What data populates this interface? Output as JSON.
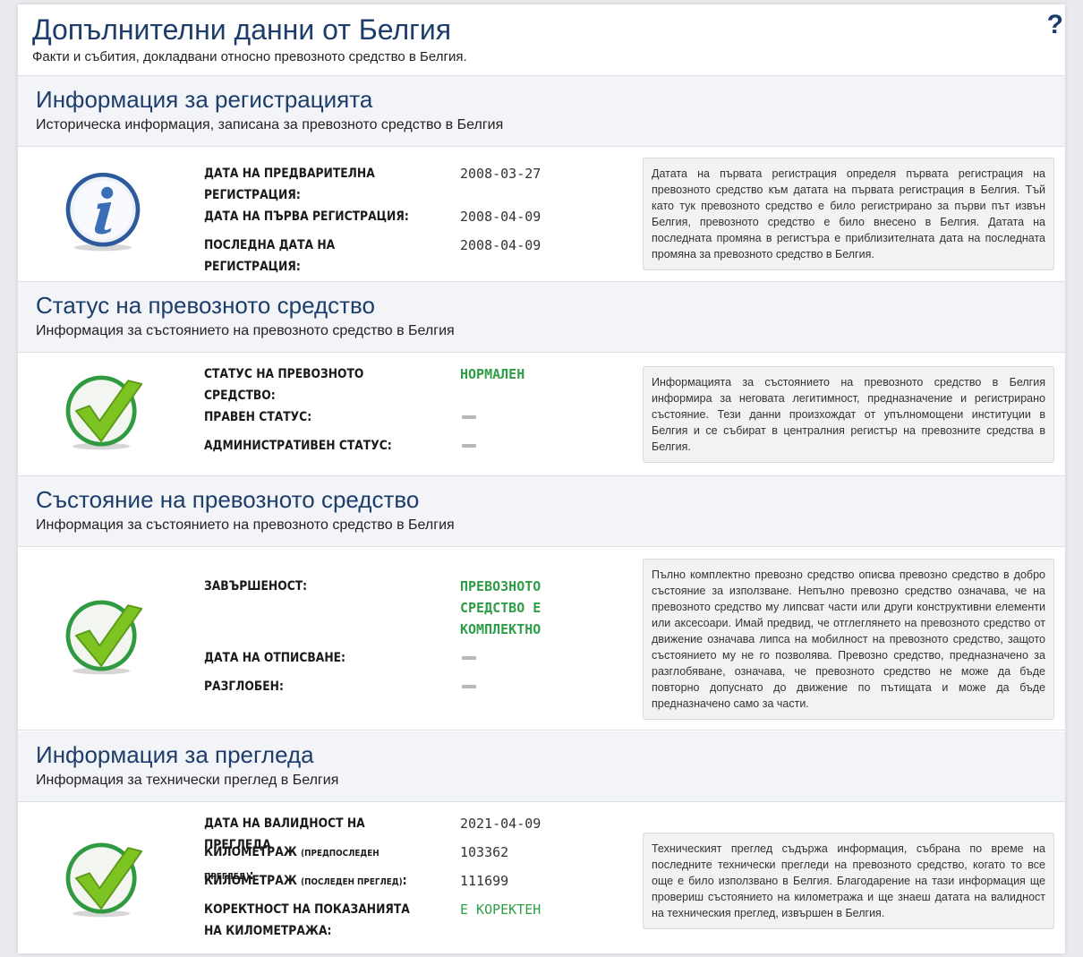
{
  "page": {
    "title": "Допълнителни данни от Белгия",
    "subtitle": "Факти и събития, докладвани относно превозното средство в Белгия.",
    "help_icon": "?"
  },
  "colors": {
    "accent": "#1d3d6b",
    "ok": "#2e9e46",
    "info_blue": "#2c5a9a"
  },
  "sections": [
    {
      "title": "Информация за регистрацията",
      "subtitle": "Историческа информация, записана за превозното средство в Белгия",
      "icon": "info-icon",
      "rows": [
        {
          "label": "ДАТА НА ПРЕДВАРИТЕЛНА РЕГИСТРАЦИЯ:",
          "value": "2008-03-27"
        },
        {
          "label": "ДАТА НА ПЪРВА РЕГИСТРАЦИЯ:",
          "value": "2008-04-09"
        },
        {
          "label": "ПОСЛЕДНА ДАТА НА РЕГИСТРАЦИЯ:",
          "value": "2008-04-09"
        }
      ],
      "note": "Датата на първата регистрация определя първата регистрация на превозното средство към датата на първата регистрация в Белгия. Тъй като тук превозното средство е било регистрирано за първи път извън Белгия, превозното средство е било внесено в Белгия. Датата на последната промяна в регистъра е приблизителната дата на последната промяна за превозното средство в Белгия."
    },
    {
      "title": "Статус на превозното средство",
      "subtitle": "Информация за състоянието на превозното средство в Белгия",
      "icon": "check-icon",
      "rows": [
        {
          "label": "СТАТУС НА ПРЕВОЗНОТО СРЕДСТВО:",
          "value": "НОРМАЛЕН"
        },
        {
          "label": "ПРАВЕН СТАТУС:",
          "value": ""
        },
        {
          "label": "АДМИНИСТРАТИВЕН СТАТУС:",
          "value": ""
        }
      ],
      "note": "Информацията за състоянието на превозното средство в Белгия информира за неговата легитимност, предназначение и регистрирано състояние. Тези данни произхождат от упълномощени институции в Белгия и се събират в централния регистър на превозните средства в Белгия."
    },
    {
      "title": "Състояние на превозното средство",
      "subtitle": "Информация за състоянието на превозното средство в Белгия",
      "icon": "check-icon",
      "rows": [
        {
          "label": "ЗАВЪРШЕНОСТ:",
          "value_lines": [
            "ПРЕВОЗНОТО",
            "СРЕДСТВО Е",
            "КОМПЛЕКТНО"
          ]
        },
        {
          "label": "ДАТА НА ОТПИСВАНЕ:",
          "value": ""
        },
        {
          "label": "РАЗГЛОБЕН:",
          "value": ""
        }
      ],
      "note": "Пълно комплектно превозно средство описва превозно средство в добро състояние за използване. Непълно превозно средство означава, че на превозното средство му липсват части или други конструктивни елементи или аксесоари. Имай предвид, че отглеглянето на превозното средство от движение означава липса на мобилност на превозното средство, защото състоянието му не го позволява. Превозно средство, предназначено за разглобяване, означава, че превозното средство не може да бъде повторно допуснато до движение по пътищата и може да бъде предназначено само за части."
    },
    {
      "title": "Информация за прегледа",
      "subtitle": "Информация за технически преглед в Белгия",
      "icon": "check-icon",
      "rows": [
        {
          "label": "ДАТА НА ВАЛИДНОСТ НА ПРЕГЛЕДА",
          "value": "2021-04-09"
        },
        {
          "label": "КИЛОМЕТРАЖ",
          "label_small": "(ПРЕДПОСЛЕДЕН ПРЕГЛЕД)",
          "label_end": ":",
          "value": "103362"
        },
        {
          "label": "КИЛОМЕТРАЖ",
          "label_small": "(ПОСЛЕДЕН ПРЕГЛЕД)",
          "label_end": ":",
          "value": "111699"
        },
        {
          "label": "КОРЕКТНОСТ НА ПОКАЗАНИЯТА НА КИЛОМЕТРАЖА:",
          "value": "Е КОРЕКТЕН"
        }
      ],
      "note": "Техническият преглед съдържа информация, събрана по време на последните технически прегледи на превозното средство, когато то все още е било използвано в Белгия. Благодарение на тази информация ще провериш състоянието на километража и ще знаеш датата на валидност на техническия преглед, извършен в Белгия."
    }
  ]
}
